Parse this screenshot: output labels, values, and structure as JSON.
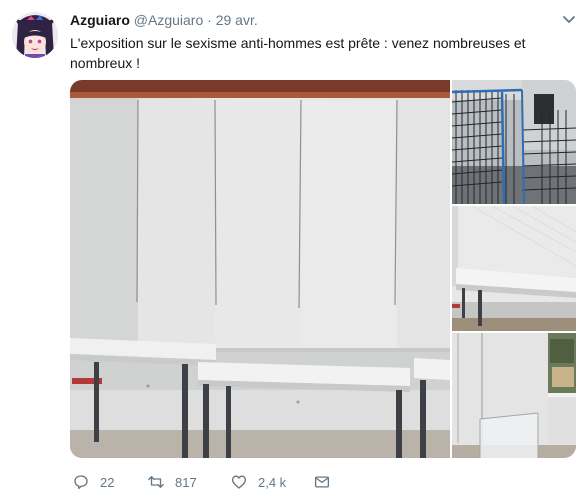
{
  "tweet": {
    "display_name": "Azguiaro",
    "handle": "@Azguiaro",
    "separator": "·",
    "date": "29 avr.",
    "text": "L'exposition sur le sexisme anti-hommes est prête : venez nombreuses et nombreux !",
    "photos": [
      {
        "description_icon": "photo-empty-white-panels"
      },
      {
        "description_icon": "photo-wire-grid-panels"
      },
      {
        "description_icon": "photo-panel-with-table"
      },
      {
        "description_icon": "photo-corner-with-vitrine"
      }
    ]
  },
  "actions": {
    "reply_count": "22",
    "retweet_count": "817",
    "like_count": "2,4 k"
  },
  "colors": {
    "text_primary": "#14171a",
    "text_secondary": "#657786"
  }
}
